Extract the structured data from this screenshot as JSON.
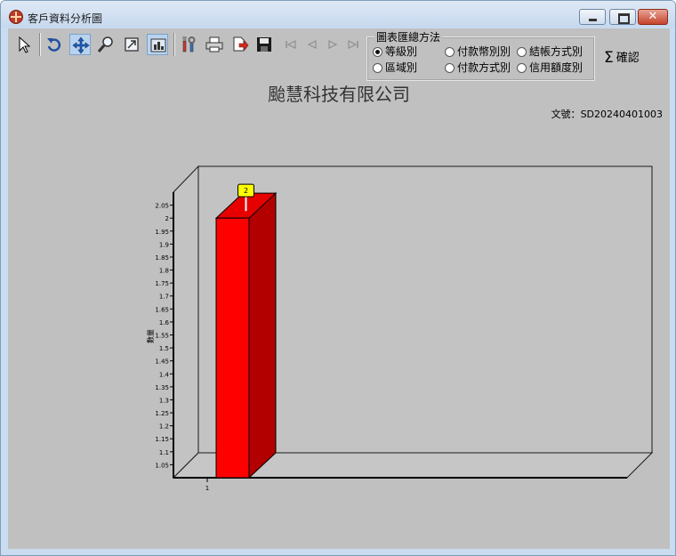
{
  "window": {
    "title": "客戶資料分析圖",
    "controls": {
      "minimize": "minimize",
      "maximize": "maximize",
      "close": "✕"
    }
  },
  "toolbar": {
    "buttons": [
      {
        "name": "pointer-tool",
        "icon": "arrow-pointer-icon"
      },
      {
        "name": "rotate-tool",
        "icon": "rotate-icon"
      },
      {
        "name": "move-tool",
        "icon": "move-arrows-icon",
        "pressed": true
      },
      {
        "name": "zoom-tool",
        "icon": "magnifier-icon"
      },
      {
        "name": "zoom-box-tool",
        "icon": "zoom-box-icon"
      },
      {
        "name": "3d-view-toggle",
        "icon": "3d-view-icon",
        "pressed": true
      },
      {
        "name": "chart-settings",
        "icon": "settings-tools-icon"
      },
      {
        "name": "print",
        "icon": "printer-icon"
      },
      {
        "name": "export",
        "icon": "export-icon"
      },
      {
        "name": "save",
        "icon": "floppy-disk-icon"
      },
      {
        "name": "first-page",
        "icon": "first-page-icon",
        "disabled": true
      },
      {
        "name": "prev-page",
        "icon": "prev-page-icon",
        "disabled": true
      },
      {
        "name": "next-page",
        "icon": "next-page-icon",
        "disabled": true
      },
      {
        "name": "last-page",
        "icon": "last-page-icon",
        "disabled": true
      }
    ]
  },
  "group": {
    "title": "圖表匯總方法",
    "options": [
      {
        "label": "等級別",
        "checked": true
      },
      {
        "label": "付款幣別別",
        "checked": false
      },
      {
        "label": "結帳方式別",
        "checked": false
      },
      {
        "label": "區域別",
        "checked": false
      },
      {
        "label": "付款方式別",
        "checked": false
      },
      {
        "label": "信用額度別",
        "checked": false
      }
    ]
  },
  "confirm": {
    "label": "確認",
    "icon": "sigma-icon"
  },
  "report": {
    "company": "颱慧科技有限公司",
    "doc_label": "文號：",
    "doc_number": "SD20240401003"
  },
  "chart_data": {
    "type": "bar",
    "categories": [
      "1"
    ],
    "values": [
      2
    ],
    "data_labels": [
      "2"
    ],
    "ylabel": "數量",
    "ylim": [
      1.0,
      2.1
    ],
    "yticks": [
      1.05,
      1.1,
      1.15,
      1.2,
      1.25,
      1.3,
      1.35,
      1.4,
      1.45,
      1.5,
      1.55,
      1.6,
      1.65,
      1.7,
      1.75,
      1.8,
      1.85,
      1.9,
      1.95,
      2,
      2.05
    ],
    "ytick_labels": [
      "1.05",
      "1.1",
      "1.15",
      "1.2",
      "1.25",
      "1.3",
      "1.35",
      "1.4",
      "1.45",
      "1.5",
      "1.55",
      "1.6",
      "1.65",
      "1.7",
      "1.75",
      "1.8",
      "1.85",
      "1.9",
      "1.95",
      "2",
      "2.05"
    ],
    "view": "3d",
    "grid": false,
    "colors": {
      "bar_front": "#ff0000",
      "bar_top": "#e60000",
      "bar_side": "#b20000",
      "label_bg": "#ffff00"
    }
  }
}
